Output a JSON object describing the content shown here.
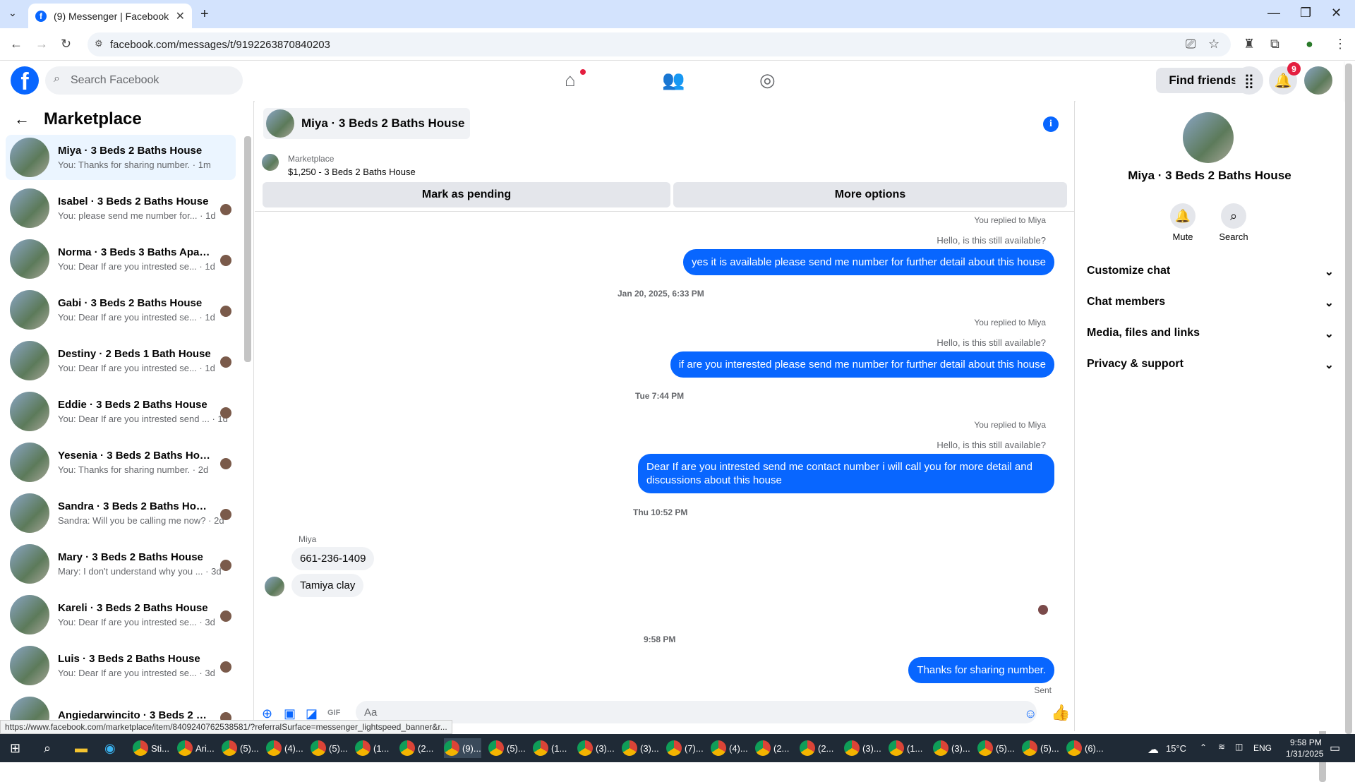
{
  "browser": {
    "tab_title": "(9) Messenger | Facebook",
    "tab_favicon": "f",
    "url": "facebook.com/messages/t/9192263870840203",
    "status_link": "https://www.facebook.com/marketplace/item/840924076253858​1/?referralSurface=messenger_lightspeed_banner&r..."
  },
  "header": {
    "search_placeholder": "Search Facebook",
    "find_friends": "Find friends",
    "notif_count": "9",
    "accent": "#0866ff"
  },
  "left": {
    "title": "Marketplace",
    "conversations": [
      {
        "name": "Miya · 3 Beds 2 Baths House",
        "preview": "You: Thanks for sharing number. · 1m",
        "active": true
      },
      {
        "name": "Isabel · 3 Beds 2 Baths House",
        "preview": "You: please send me number for... · 1d"
      },
      {
        "name": "Norma · 3 Beds 3 Baths Apart...",
        "preview": "You: Dear If are you intrested se... · 1d"
      },
      {
        "name": "Gabi · 3 Beds 2 Baths House",
        "preview": "You: Dear If are you intrested se... · 1d"
      },
      {
        "name": "Destiny · 2 Beds 1 Bath House",
        "preview": "You: Dear If are you intrested se... · 1d"
      },
      {
        "name": "Eddie · 3 Beds 2 Baths House",
        "preview": "You: Dear If are you intrested send ... · 1d"
      },
      {
        "name": "Yesenia · 3 Beds 2 Baths House",
        "preview": "You: Thanks for sharing number. · 2d"
      },
      {
        "name": "Sandra · 3 Beds 2 Baths House",
        "preview": "Sandra: Will you be calling me now? · 2d"
      },
      {
        "name": "Mary · 3 Beds 2 Baths House",
        "preview": "Mary: I don't understand why you ... · 3d"
      },
      {
        "name": "Kareli · 3 Beds 2 Baths House",
        "preview": "You: Dear If are you intrested se... · 3d"
      },
      {
        "name": "Luis · 3 Beds 2 Baths House",
        "preview": "You: Dear If are you intrested se... · 3d"
      },
      {
        "name": "Angiedarwincito · 3 Beds 2 Ba...",
        "preview": ""
      }
    ]
  },
  "chat": {
    "title": "Miya · 3 Beds 2 Baths House",
    "marketplace_label": "Marketplace",
    "listing": "$1,250 - 3 Beds 2 Baths House",
    "mark_pending": "Mark as pending",
    "more_options": "More options",
    "replied": "You replied to Miya",
    "quoted": "Hello, is this still available?",
    "msg1": "yes it is available please send me number for further detail about this house",
    "time1": "Jan 20, 2025, 6:33 PM",
    "msg2": "if are you interested  please send me number for further detail about this house",
    "time2": "Tue 7:44 PM",
    "msg3": "Dear    If are you intrested  send me contact number  i will call you for more detail and discussions about this house",
    "time3": "Thu 10:52 PM",
    "sender": "Miya",
    "in1": "661-236-1409",
    "in2": "Tamiya clay",
    "time4": "9:58 PM",
    "msg4": "Thanks for sharing number.",
    "sent": "Sent",
    "input_placeholder": "Aa"
  },
  "right": {
    "title": "Miya · 3 Beds 2 Baths House",
    "mute": "Mute",
    "search": "Search",
    "sections": [
      "Customize chat",
      "Chat members",
      "Media, files and links",
      "Privacy & support"
    ]
  },
  "taskbar": {
    "temp": "15°C",
    "lang": "ENG",
    "time": "9:58 PM",
    "date": "1/31/2025",
    "items": [
      "Sti...",
      "Ari...",
      "(5)...",
      "(4)...",
      "(5)...",
      "(1...",
      "(2...",
      "(9)...",
      "(5)...",
      "(1...",
      "(3)...",
      "(3)...",
      "(7)...",
      "(4)...",
      "(2...",
      "(2...",
      "(3)...",
      "(1...",
      "(3)...",
      "(5)...",
      "(5)...",
      "(6)..."
    ]
  }
}
